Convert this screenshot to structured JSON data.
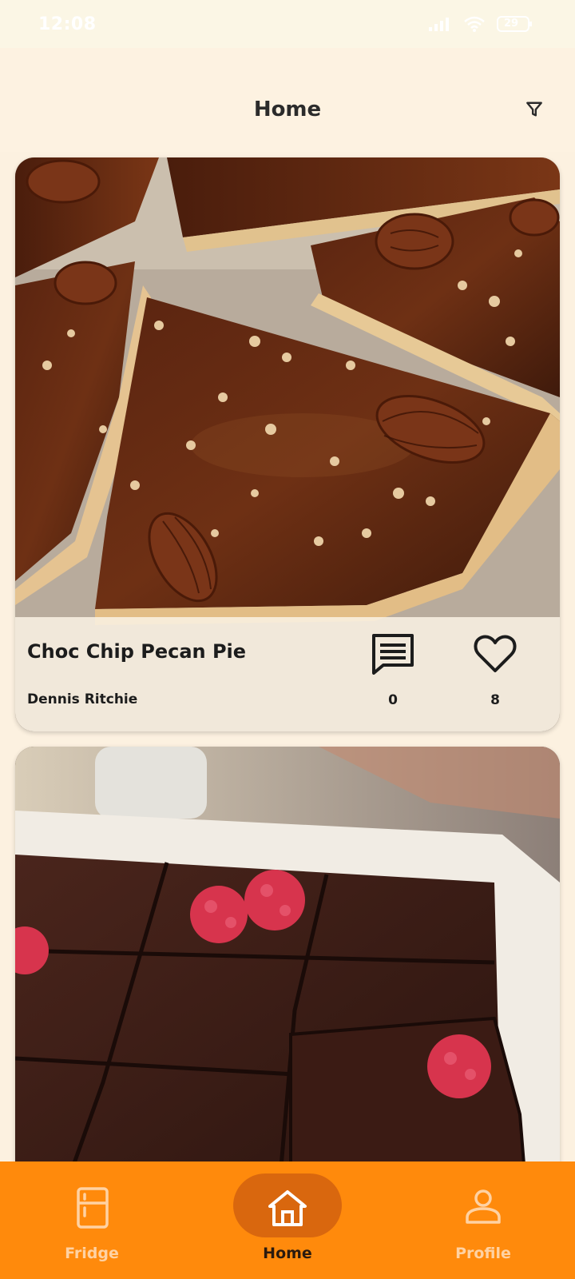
{
  "status_bar": {
    "time": "12:08",
    "battery": "29"
  },
  "app_bar": {
    "title": "Home",
    "filter_icon": "filter-icon"
  },
  "posts": [
    {
      "title": "Choc Chip Pecan Pie",
      "author": "Dennis Ritchie",
      "comments": "0",
      "likes": "8",
      "comment_icon": "comment-icon",
      "like_icon": "heart-outline-icon"
    },
    {
      "title": "",
      "author": ""
    }
  ],
  "bottom_nav": {
    "items": [
      {
        "label": "Fridge",
        "icon": "fridge-icon",
        "selected": false
      },
      {
        "label": "Home",
        "icon": "home-icon",
        "selected": true
      },
      {
        "label": "Profile",
        "icon": "profile-icon",
        "selected": false
      }
    ]
  },
  "colors": {
    "background": "#FCF1E0",
    "nav_background": "#FF8A0C",
    "nav_selected_pill": "#D9670E",
    "card_overlay": "#FAF2E4"
  }
}
